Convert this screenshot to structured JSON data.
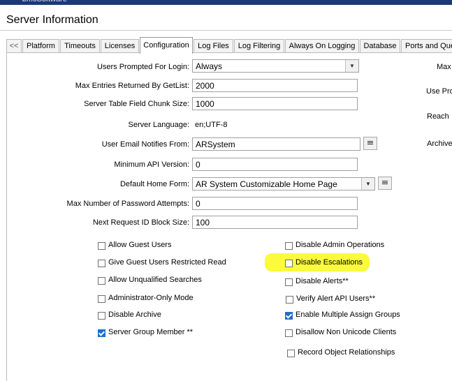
{
  "brand": "bmcSoftware",
  "page_title": "Server Information",
  "tabs": [
    {
      "label": "<<"
    },
    {
      "label": "Platform"
    },
    {
      "label": "Timeouts"
    },
    {
      "label": "Licenses"
    },
    {
      "label": "Configuration"
    },
    {
      "label": "Log Files"
    },
    {
      "label": "Log Filtering"
    },
    {
      "label": "Always On Logging"
    },
    {
      "label": "Database"
    },
    {
      "label": "Ports and Queues"
    }
  ],
  "active_tab": "Configuration",
  "fields": {
    "users_prompted": {
      "label": "Users Prompted For Login:",
      "value": "Always"
    },
    "max_entries": {
      "label": "Max Entries Returned By GetList:",
      "value": "2000"
    },
    "chunk_size": {
      "label": "Server Table Field Chunk Size:",
      "value": "1000"
    },
    "server_language": {
      "label": "Server Language:",
      "value": "en;UTF-8"
    },
    "email_from": {
      "label": "User Email Notifies From:",
      "value": "ARSystem"
    },
    "min_api": {
      "label": "Minimum API Version:",
      "value": "0"
    },
    "home_form": {
      "label": "Default Home Form:",
      "value": "AR System Customizable Home Page"
    },
    "max_pwd": {
      "label": "Max Number of Password Attempts:",
      "value": "0"
    },
    "next_id_block": {
      "label": "Next Request ID Block Size:",
      "value": "100"
    }
  },
  "checkboxes_left": [
    {
      "label": "Allow Guest Users",
      "checked": false
    },
    {
      "label": "Give Guest Users Restricted Read",
      "checked": false
    },
    {
      "label": "Allow Unqualified Searches",
      "checked": false
    },
    {
      "label": "Administrator-Only Mode",
      "checked": false
    },
    {
      "label": "Disable Archive",
      "checked": false
    },
    {
      "label": "Server Group Member **",
      "checked": true
    }
  ],
  "checkboxes_right": [
    {
      "label": "Disable Admin Operations",
      "checked": false
    },
    {
      "label": "Disable Escalations",
      "checked": false
    },
    {
      "label": "Disable Alerts**",
      "checked": false
    },
    {
      "label": "Verify Alert API Users**",
      "checked": false
    },
    {
      "label": "Enable Multiple Assign Groups",
      "checked": true
    },
    {
      "label": "Disallow Non Unicode Clients",
      "checked": false
    },
    {
      "label": "Record Object Relationships",
      "checked": false
    }
  ],
  "right_column_labels": [
    "Max",
    "Use Pro",
    "Reach",
    "Archive"
  ],
  "colors": {
    "highlight": "#fbfa3c",
    "checked": "#1a6fd0",
    "banner": "#1b3a73"
  }
}
